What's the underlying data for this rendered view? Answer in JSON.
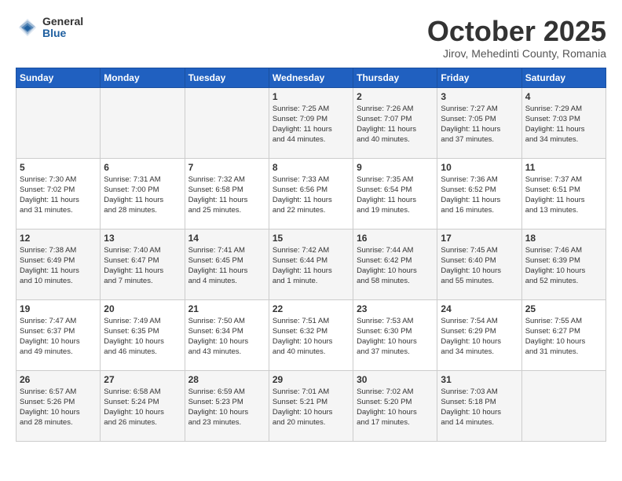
{
  "header": {
    "logo_general": "General",
    "logo_blue": "Blue",
    "month_title": "October 2025",
    "location": "Jirov, Mehedinti County, Romania"
  },
  "days_of_week": [
    "Sunday",
    "Monday",
    "Tuesday",
    "Wednesday",
    "Thursday",
    "Friday",
    "Saturday"
  ],
  "weeks": [
    [
      {
        "day": "",
        "info": ""
      },
      {
        "day": "",
        "info": ""
      },
      {
        "day": "",
        "info": ""
      },
      {
        "day": "1",
        "info": "Sunrise: 7:25 AM\nSunset: 7:09 PM\nDaylight: 11 hours\nand 44 minutes."
      },
      {
        "day": "2",
        "info": "Sunrise: 7:26 AM\nSunset: 7:07 PM\nDaylight: 11 hours\nand 40 minutes."
      },
      {
        "day": "3",
        "info": "Sunrise: 7:27 AM\nSunset: 7:05 PM\nDaylight: 11 hours\nand 37 minutes."
      },
      {
        "day": "4",
        "info": "Sunrise: 7:29 AM\nSunset: 7:03 PM\nDaylight: 11 hours\nand 34 minutes."
      }
    ],
    [
      {
        "day": "5",
        "info": "Sunrise: 7:30 AM\nSunset: 7:02 PM\nDaylight: 11 hours\nand 31 minutes."
      },
      {
        "day": "6",
        "info": "Sunrise: 7:31 AM\nSunset: 7:00 PM\nDaylight: 11 hours\nand 28 minutes."
      },
      {
        "day": "7",
        "info": "Sunrise: 7:32 AM\nSunset: 6:58 PM\nDaylight: 11 hours\nand 25 minutes."
      },
      {
        "day": "8",
        "info": "Sunrise: 7:33 AM\nSunset: 6:56 PM\nDaylight: 11 hours\nand 22 minutes."
      },
      {
        "day": "9",
        "info": "Sunrise: 7:35 AM\nSunset: 6:54 PM\nDaylight: 11 hours\nand 19 minutes."
      },
      {
        "day": "10",
        "info": "Sunrise: 7:36 AM\nSunset: 6:52 PM\nDaylight: 11 hours\nand 16 minutes."
      },
      {
        "day": "11",
        "info": "Sunrise: 7:37 AM\nSunset: 6:51 PM\nDaylight: 11 hours\nand 13 minutes."
      }
    ],
    [
      {
        "day": "12",
        "info": "Sunrise: 7:38 AM\nSunset: 6:49 PM\nDaylight: 11 hours\nand 10 minutes."
      },
      {
        "day": "13",
        "info": "Sunrise: 7:40 AM\nSunset: 6:47 PM\nDaylight: 11 hours\nand 7 minutes."
      },
      {
        "day": "14",
        "info": "Sunrise: 7:41 AM\nSunset: 6:45 PM\nDaylight: 11 hours\nand 4 minutes."
      },
      {
        "day": "15",
        "info": "Sunrise: 7:42 AM\nSunset: 6:44 PM\nDaylight: 11 hours\nand 1 minute."
      },
      {
        "day": "16",
        "info": "Sunrise: 7:44 AM\nSunset: 6:42 PM\nDaylight: 10 hours\nand 58 minutes."
      },
      {
        "day": "17",
        "info": "Sunrise: 7:45 AM\nSunset: 6:40 PM\nDaylight: 10 hours\nand 55 minutes."
      },
      {
        "day": "18",
        "info": "Sunrise: 7:46 AM\nSunset: 6:39 PM\nDaylight: 10 hours\nand 52 minutes."
      }
    ],
    [
      {
        "day": "19",
        "info": "Sunrise: 7:47 AM\nSunset: 6:37 PM\nDaylight: 10 hours\nand 49 minutes."
      },
      {
        "day": "20",
        "info": "Sunrise: 7:49 AM\nSunset: 6:35 PM\nDaylight: 10 hours\nand 46 minutes."
      },
      {
        "day": "21",
        "info": "Sunrise: 7:50 AM\nSunset: 6:34 PM\nDaylight: 10 hours\nand 43 minutes."
      },
      {
        "day": "22",
        "info": "Sunrise: 7:51 AM\nSunset: 6:32 PM\nDaylight: 10 hours\nand 40 minutes."
      },
      {
        "day": "23",
        "info": "Sunrise: 7:53 AM\nSunset: 6:30 PM\nDaylight: 10 hours\nand 37 minutes."
      },
      {
        "day": "24",
        "info": "Sunrise: 7:54 AM\nSunset: 6:29 PM\nDaylight: 10 hours\nand 34 minutes."
      },
      {
        "day": "25",
        "info": "Sunrise: 7:55 AM\nSunset: 6:27 PM\nDaylight: 10 hours\nand 31 minutes."
      }
    ],
    [
      {
        "day": "26",
        "info": "Sunrise: 6:57 AM\nSunset: 5:26 PM\nDaylight: 10 hours\nand 28 minutes."
      },
      {
        "day": "27",
        "info": "Sunrise: 6:58 AM\nSunset: 5:24 PM\nDaylight: 10 hours\nand 26 minutes."
      },
      {
        "day": "28",
        "info": "Sunrise: 6:59 AM\nSunset: 5:23 PM\nDaylight: 10 hours\nand 23 minutes."
      },
      {
        "day": "29",
        "info": "Sunrise: 7:01 AM\nSunset: 5:21 PM\nDaylight: 10 hours\nand 20 minutes."
      },
      {
        "day": "30",
        "info": "Sunrise: 7:02 AM\nSunset: 5:20 PM\nDaylight: 10 hours\nand 17 minutes."
      },
      {
        "day": "31",
        "info": "Sunrise: 7:03 AM\nSunset: 5:18 PM\nDaylight: 10 hours\nand 14 minutes."
      },
      {
        "day": "",
        "info": ""
      }
    ]
  ]
}
